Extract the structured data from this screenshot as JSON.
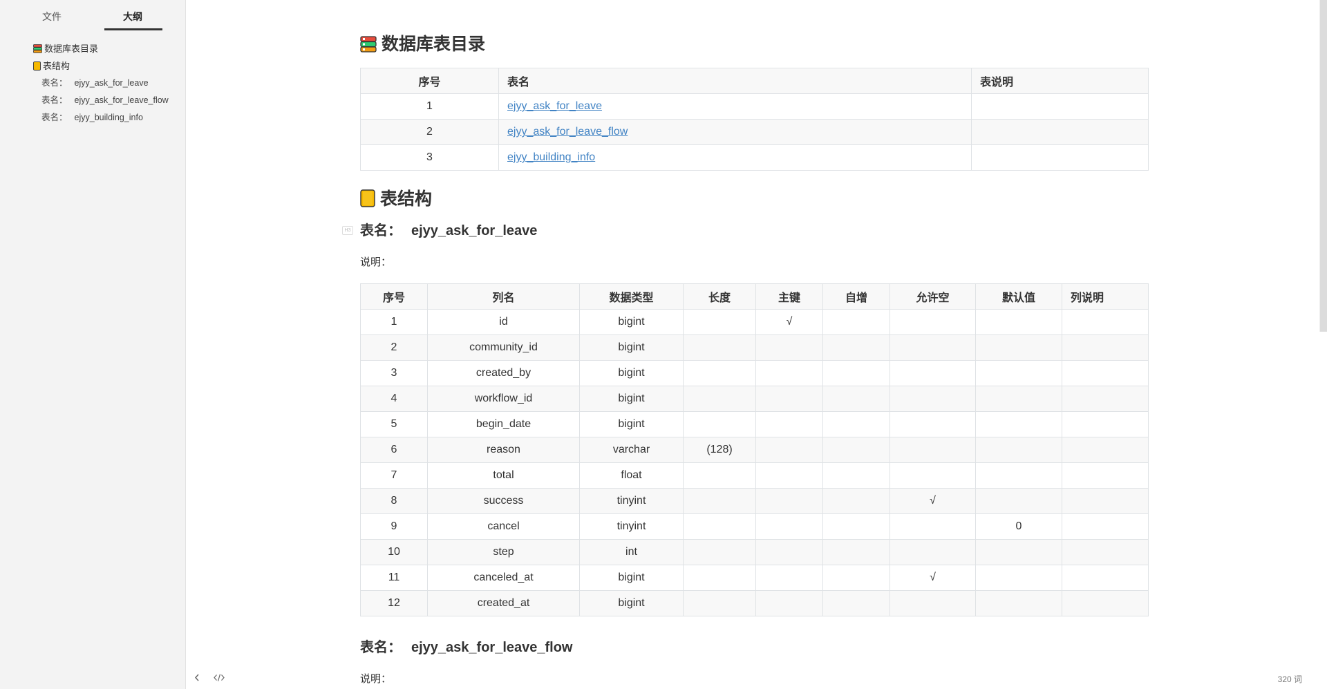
{
  "sidebar": {
    "tabs": [
      {
        "label": "文件"
      },
      {
        "label": "大纲"
      }
    ],
    "outline": [
      {
        "icon": "books-icon",
        "label": "数据库表目录"
      },
      {
        "icon": "orange-book-icon",
        "label": "表结构"
      },
      {
        "prefix": "表名：",
        "label": "ejyy_ask_for_leave"
      },
      {
        "prefix": "表名：",
        "label": "ejyy_ask_for_leave_flow"
      },
      {
        "prefix": "表名：",
        "label": "ejyy_building_info"
      }
    ]
  },
  "doc": {
    "catalog": {
      "heading": "数据库表目录",
      "headers": [
        "序号",
        "表名",
        "表说明"
      ],
      "rows": [
        {
          "no": "1",
          "name": "ejyy_ask_for_leave",
          "desc": ""
        },
        {
          "no": "2",
          "name": "ejyy_ask_for_leave_flow",
          "desc": ""
        },
        {
          "no": "3",
          "name": "ejyy_building_info",
          "desc": ""
        }
      ]
    },
    "structure": {
      "heading": "表结构"
    },
    "table1": {
      "prefix": "表名：",
      "name": "ejyy_ask_for_leave",
      "desc_label": "说明：",
      "headers": [
        "序号",
        "列名",
        "数据类型",
        "长度",
        "主键",
        "自增",
        "允许空",
        "默认值",
        "列说明"
      ],
      "rows": [
        [
          "1",
          "id",
          "bigint",
          "",
          "√",
          "",
          "",
          "",
          ""
        ],
        [
          "2",
          "community_id",
          "bigint",
          "",
          "",
          "",
          "",
          "",
          ""
        ],
        [
          "3",
          "created_by",
          "bigint",
          "",
          "",
          "",
          "",
          "",
          ""
        ],
        [
          "4",
          "workflow_id",
          "bigint",
          "",
          "",
          "",
          "",
          "",
          ""
        ],
        [
          "5",
          "begin_date",
          "bigint",
          "",
          "",
          "",
          "",
          "",
          ""
        ],
        [
          "6",
          "reason",
          "varchar",
          "(128)",
          "",
          "",
          "",
          "",
          ""
        ],
        [
          "7",
          "total",
          "float",
          "",
          "",
          "",
          "",
          "",
          ""
        ],
        [
          "8",
          "success",
          "tinyint",
          "",
          "",
          "",
          "√",
          "",
          ""
        ],
        [
          "9",
          "cancel",
          "tinyint",
          "",
          "",
          "",
          "",
          "0",
          ""
        ],
        [
          "10",
          "step",
          "int",
          "",
          "",
          "",
          "",
          "",
          ""
        ],
        [
          "11",
          "canceled_at",
          "bigint",
          "",
          "",
          "",
          "√",
          "",
          ""
        ],
        [
          "12",
          "created_at",
          "bigint",
          "",
          "",
          "",
          "",
          "",
          ""
        ]
      ]
    },
    "table2": {
      "prefix": "表名：",
      "name": "ejyy_ask_for_leave_flow",
      "desc_label": "说明："
    }
  },
  "footer": {
    "collapse_icon": "chevron-left-icon",
    "source_icon": "code-icon",
    "word_count": "320 词"
  },
  "colors": {
    "link": "#4183c4",
    "sidebar_bg": "#f3f3f3",
    "table_border": "#dfe2e5",
    "table_stripe": "#f8f8f8"
  }
}
